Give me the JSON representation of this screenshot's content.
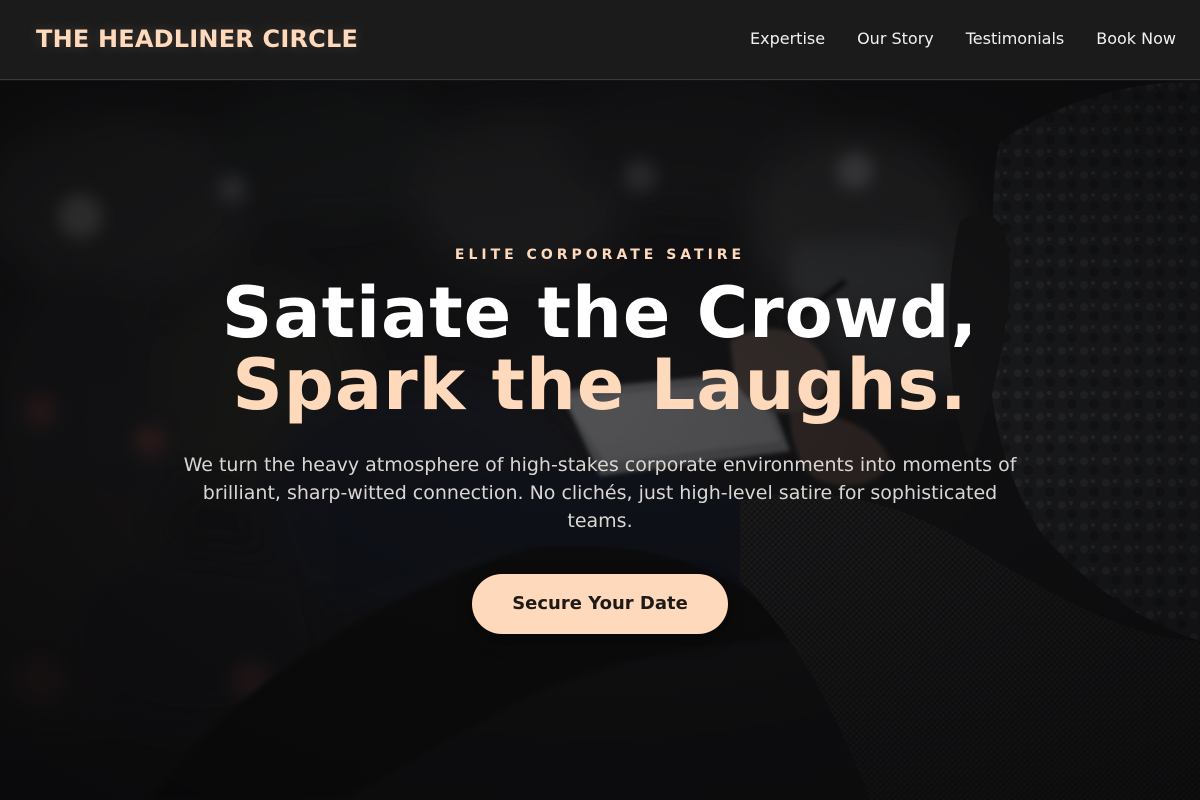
{
  "header": {
    "brand": "THE HEADLINER CIRCLE",
    "nav": [
      {
        "label": "Expertise"
      },
      {
        "label": "Our Story"
      },
      {
        "label": "Testimonials"
      },
      {
        "label": "Book Now"
      }
    ]
  },
  "hero": {
    "eyebrow": "ELITE CORPORATE SATIRE",
    "headline_line1": "Satiate the Crowd,",
    "headline_line2": "Spark the Laughs.",
    "description": "We turn the heavy atmosphere of high-stakes corporate environments into moments of brilliant, sharp-witted connection. No clichés, just high-level satire for sophisticated teams.",
    "cta_label": "Secure Your Date",
    "background": "dark blurred audience photo, person writing in a notebook"
  },
  "colors": {
    "accent": "#ffd9bb",
    "nav_background": "#1b1b1b",
    "text_light": "#ffffff"
  }
}
